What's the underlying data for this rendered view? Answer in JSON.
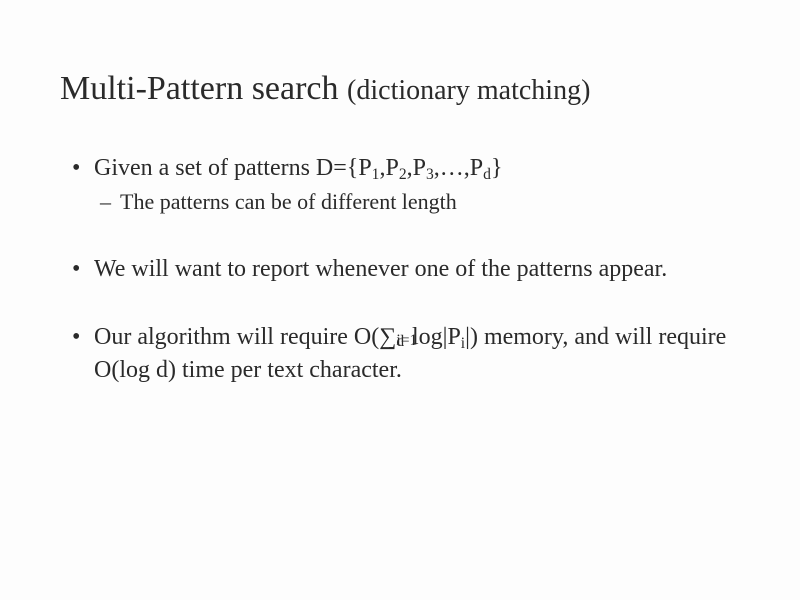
{
  "title_main": "Multi-Pattern search ",
  "title_sub": "(dictionary matching)",
  "bullets": [
    {
      "text_a": "Given a set of patterns D={P",
      "s1": "1",
      "text_b": ",P",
      "s2": "2",
      "text_c": ",P",
      "s3": "3",
      "text_d": ",…,P",
      "s4": "d",
      "text_e": "}",
      "sub": "The patterns can be of different length"
    },
    {
      "full": "We will want to report whenever one of the patterns appear."
    },
    {
      "p1": "Our algorithm will require O(",
      "sum": "∑",
      "sum_sub": "i=1",
      "sum_sup": "d",
      "p2": "log|P",
      "pi_sub": "i",
      "p3": "|) memory, and will require O(log d) time per text character."
    }
  ]
}
